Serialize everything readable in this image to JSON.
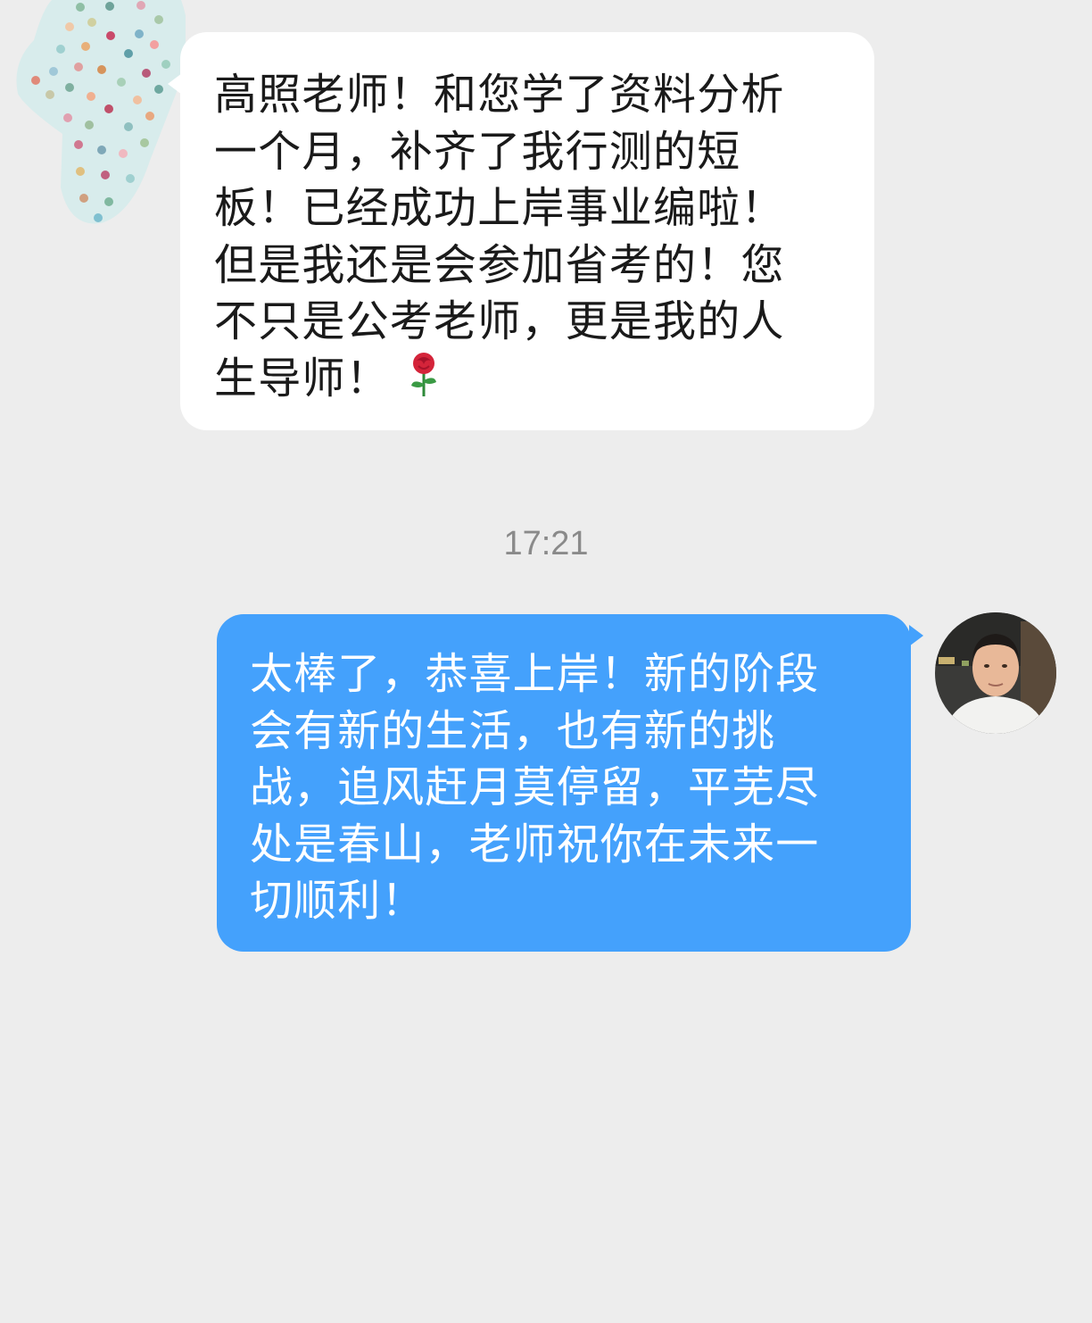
{
  "chat": {
    "incoming_message": {
      "text": "高照老师！和您学了资料分析\n一个月，补齐了我行测的短\n板！已经成功上岸事业编啦！\n但是我还是会参加省考的！您\n不只是公考老师，更是我的人\n生导师！",
      "emoji_icon": "rose-icon"
    },
    "timestamp": "17:21",
    "outgoing_message": {
      "text": "太棒了，恭喜上岸！新的阶段\n会有新的生活，也有新的挑\n战，追风赶月莫停留，平芜尽\n处是春山，老师祝你在未来一\n切顺利！"
    }
  },
  "colors": {
    "background": "#ededed",
    "incoming_bubble": "#ffffff",
    "outgoing_bubble": "#44a1fc",
    "timestamp_text": "#8a8a8a"
  }
}
